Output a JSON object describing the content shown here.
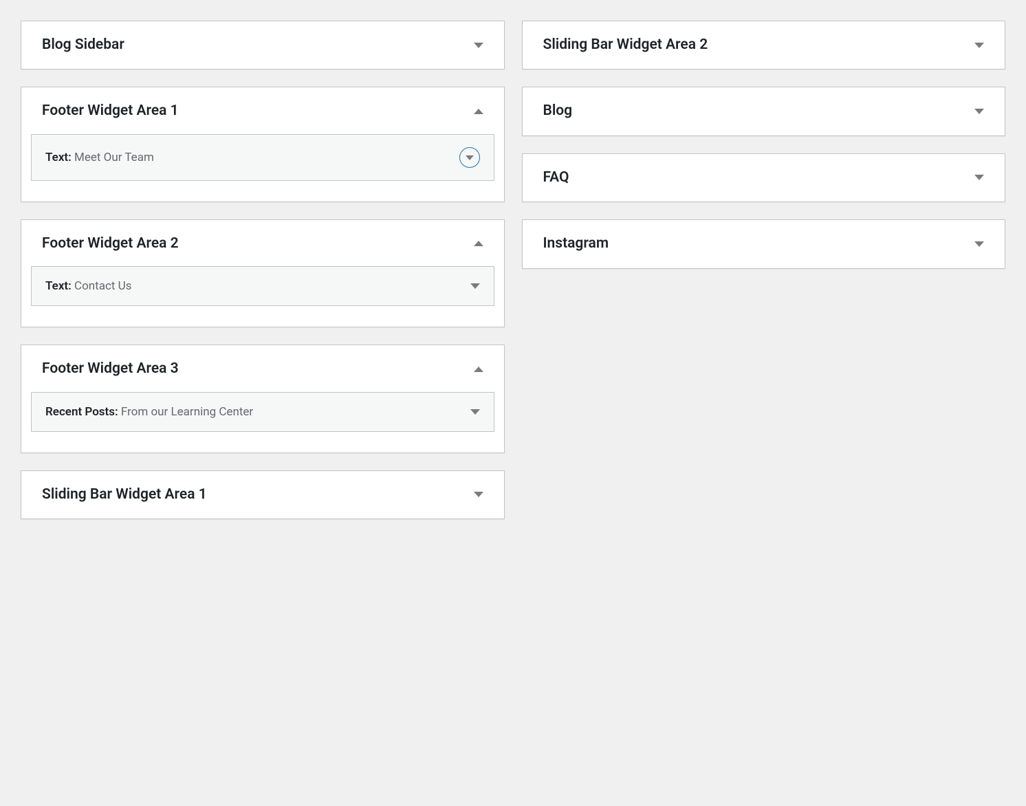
{
  "left_column": {
    "panels": [
      {
        "title": "Blog Sidebar",
        "expanded": false,
        "widgets": []
      },
      {
        "title": "Footer Widget Area 1",
        "expanded": true,
        "widgets": [
          {
            "type": "Text",
            "name": "Meet Our Team",
            "focused": true
          }
        ]
      },
      {
        "title": "Footer Widget Area 2",
        "expanded": true,
        "widgets": [
          {
            "type": "Text",
            "name": "Contact Us",
            "focused": false
          }
        ]
      },
      {
        "title": "Footer Widget Area 3",
        "expanded": true,
        "widgets": [
          {
            "type": "Recent Posts",
            "name": "From our Learning Center",
            "focused": false
          }
        ]
      },
      {
        "title": "Sliding Bar Widget Area 1",
        "expanded": false,
        "widgets": []
      }
    ]
  },
  "right_column": {
    "panels": [
      {
        "title": "Sliding Bar Widget Area 2",
        "expanded": false,
        "widgets": []
      },
      {
        "title": "Blog",
        "expanded": false,
        "widgets": []
      },
      {
        "title": "FAQ",
        "expanded": false,
        "widgets": []
      },
      {
        "title": "Instagram",
        "expanded": false,
        "widgets": []
      }
    ]
  }
}
